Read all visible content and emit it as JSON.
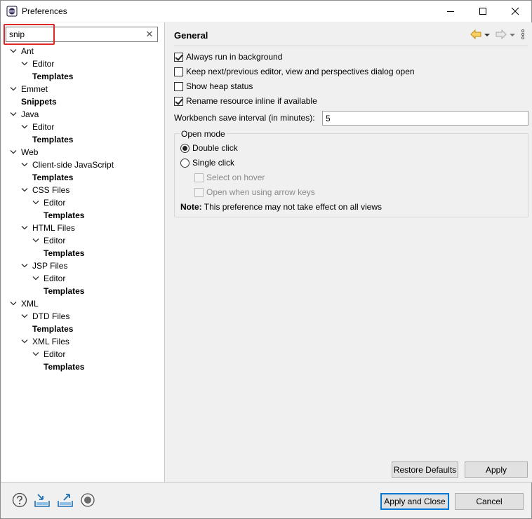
{
  "window": {
    "title": "Preferences",
    "minimize_glyph": "—",
    "maximize_glyph": "☐",
    "close_glyph": "✕"
  },
  "filter": {
    "value": "snip",
    "clear_glyph": "✕"
  },
  "tree": [
    {
      "label": "Ant",
      "bold": false
    },
    {
      "label": "Editor",
      "bold": false
    },
    {
      "label": "Templates",
      "bold": true
    },
    {
      "label": "Emmet",
      "bold": false
    },
    {
      "label": "Snippets",
      "bold": true
    },
    {
      "label": "Java",
      "bold": false
    },
    {
      "label": "Editor",
      "bold": false
    },
    {
      "label": "Templates",
      "bold": true
    },
    {
      "label": "Web",
      "bold": false
    },
    {
      "label": "Client-side JavaScript",
      "bold": false
    },
    {
      "label": "Templates",
      "bold": true
    },
    {
      "label": "CSS Files",
      "bold": false
    },
    {
      "label": "Editor",
      "bold": false
    },
    {
      "label": "Templates",
      "bold": true
    },
    {
      "label": "HTML Files",
      "bold": false
    },
    {
      "label": "Editor",
      "bold": false
    },
    {
      "label": "Templates",
      "bold": true
    },
    {
      "label": "JSP Files",
      "bold": false
    },
    {
      "label": "Editor",
      "bold": false
    },
    {
      "label": "Templates",
      "bold": true
    },
    {
      "label": "XML",
      "bold": false
    },
    {
      "label": "DTD Files",
      "bold": false
    },
    {
      "label": "Templates",
      "bold": true
    },
    {
      "label": "XML Files",
      "bold": false
    },
    {
      "label": "Editor",
      "bold": false
    },
    {
      "label": "Templates",
      "bold": true
    }
  ],
  "page": {
    "title": "General",
    "options": {
      "always_run_background": {
        "label": "Always run in background",
        "checked": true
      },
      "keep_next_prev": {
        "label": "Keep next/previous editor, view and perspectives dialog open",
        "checked": false
      },
      "show_heap": {
        "label": "Show heap status",
        "checked": false
      },
      "rename_inline": {
        "label": "Rename resource inline if available",
        "checked": true
      }
    },
    "save_interval": {
      "label": "Workbench save interval (in minutes):",
      "value": "5"
    },
    "open_mode": {
      "legend": "Open mode",
      "double_click": "Double click",
      "single_click": "Single click",
      "select_on_hover": "Select on hover",
      "open_arrow_keys": "Open when using arrow keys",
      "selected": "double_click"
    },
    "note_label": "Note:",
    "note_text": " This preference may not take effect on all views",
    "restore_defaults": "Restore Defaults",
    "apply": "Apply"
  },
  "footer": {
    "apply_and_close": "Apply and Close",
    "cancel": "Cancel"
  },
  "colors": {
    "highlight_border": "#e0282a",
    "default_button_border": "#0078d7",
    "nav_arrow": "#e8a010",
    "footer_icon": "#1f6fb2"
  }
}
